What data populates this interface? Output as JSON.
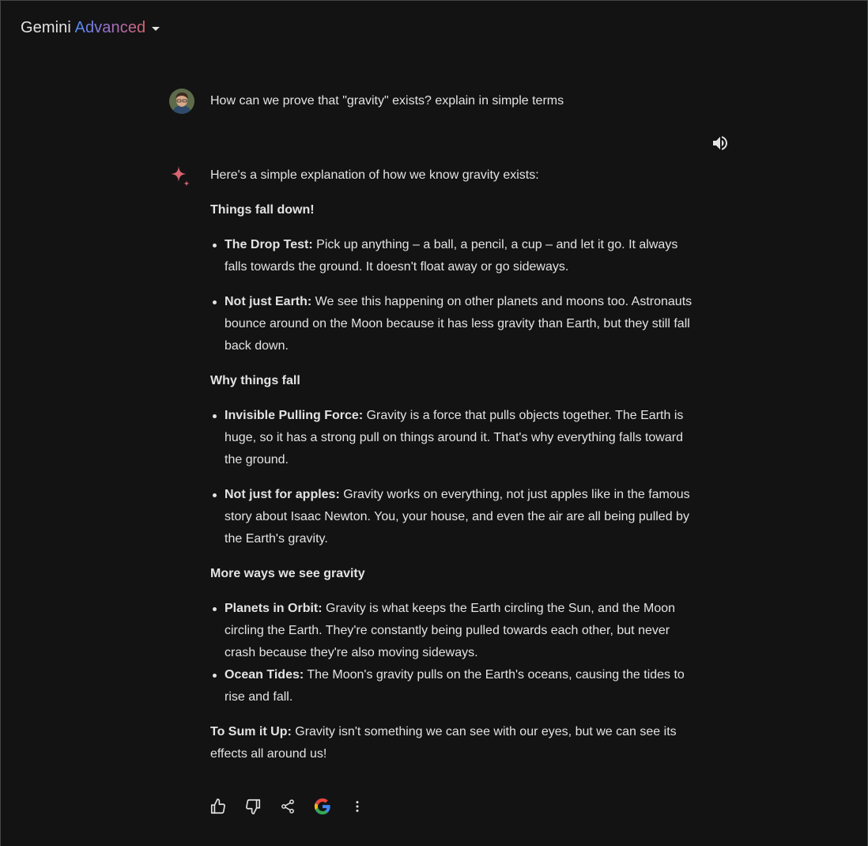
{
  "header": {
    "brand_plain": "Gemini",
    "brand_accent": "Advanced"
  },
  "user_prompt": "How can we prove that \"gravity\" exists? explain in simple terms",
  "response": {
    "intro": "Here's a simple explanation of how we know gravity exists:",
    "sections": [
      {
        "heading": "Things fall down!",
        "bullets": [
          {
            "lead": "The Drop Test:",
            "text": "  Pick up anything – a ball, a pencil, a cup – and let it go. It always falls towards the ground. It doesn't float away or go sideways."
          },
          {
            "lead": "Not just Earth:",
            "text": " We see this happening on other planets and moons too. Astronauts bounce around on the Moon because it has less gravity than Earth, but they still fall back down."
          }
        ]
      },
      {
        "heading": "Why things fall",
        "bullets": [
          {
            "lead": "Invisible Pulling Force:",
            "text": " Gravity is a force that pulls objects together. The Earth is huge, so it has a strong pull on things around it.  That's why everything falls toward the ground."
          },
          {
            "lead": "Not just for apples:",
            "text": "  Gravity works on everything, not just apples like in the famous story about Isaac Newton. You, your house, and even the air are all being pulled by the Earth's gravity."
          }
        ]
      },
      {
        "heading": "More ways we see gravity",
        "bullets": [
          {
            "lead": "Planets in Orbit:",
            "text": " Gravity is what keeps the Earth circling the Sun, and the Moon circling the Earth. They're constantly being pulled towards each other, but never crash because they're also moving sideways."
          },
          {
            "lead": "Ocean Tides:",
            "text": " The Moon's gravity pulls on the Earth's oceans, causing the tides to rise and fall."
          }
        ]
      }
    ],
    "summary_lead": "To Sum it Up:",
    "summary_text": " Gravity isn't something we can see with our eyes, but we can see its effects all around us!"
  },
  "icons": {
    "speaker": "volume-icon",
    "spark": "gemini-spark-icon",
    "actions": [
      "thumbs-up-icon",
      "thumbs-down-icon",
      "share-icon",
      "google-g-icon",
      "more-vert-icon"
    ]
  },
  "colors": {
    "background": "#131314",
    "text": "#e3e3e3",
    "accent_gradient": [
      "#4f8ef7",
      "#9b72cb",
      "#d96570"
    ],
    "spark": "#d96570"
  }
}
